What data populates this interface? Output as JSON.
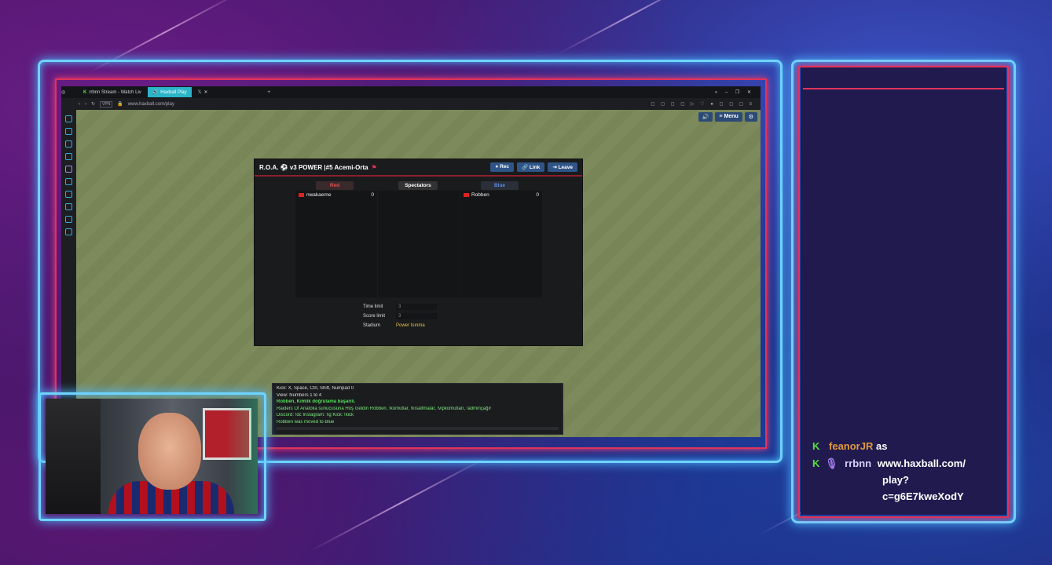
{
  "browser": {
    "tabs": [
      {
        "label": "rrbnn Stream - Watch Liv",
        "active": false
      },
      {
        "label": "Haxball Play",
        "active": true
      },
      {
        "label": "",
        "active": false
      }
    ],
    "url": "www.haxball.com/play",
    "menu_label": "Menu"
  },
  "room": {
    "title": "R.O.A. ⚽ v3 POWER |#5 Acemi-Orta",
    "buttons": {
      "rec": "Rec",
      "link": "Link",
      "leave": "Leave"
    },
    "teams": {
      "red": {
        "label": "Red",
        "players": [
          {
            "name": "nwakaeme",
            "score": "0"
          }
        ]
      },
      "spectators": {
        "label": "Spectators",
        "players": []
      },
      "blue": {
        "label": "Blue",
        "players": [
          {
            "name": "Robben",
            "score": "0"
          }
        ]
      }
    },
    "settings": {
      "time_label": "Time limit",
      "time_value": "3",
      "score_label": "Score limit",
      "score_value": "3",
      "stadium_label": "Stadium",
      "stadium_value": "Power Isınma"
    }
  },
  "chat": {
    "lines": [
      "Kick: X, Space, Ctrl, Shift, Numpad 0",
      "View: Numbers 1 to 4",
      "Robben, Kimlik doğrulama başarılı.",
      "Raiders Of Anatolia sunucusuna Hoş Geldin Robben. !komutlar, !kısaltmalar, !vipkomutları, !adminçağır",
      "Discord: !dc  Instagram: !ig  Kick: !kick",
      "Robben was moved to Blue"
    ]
  },
  "stream_chat": {
    "msg1_user": "feanorJR",
    "msg1_text": "as",
    "msg2_user": "rrbnn",
    "msg2_line1": "www.haxball.com/",
    "msg2_line2": "play?",
    "msg2_line3": "c=g6E7kweXodY",
    "badge": "K"
  }
}
